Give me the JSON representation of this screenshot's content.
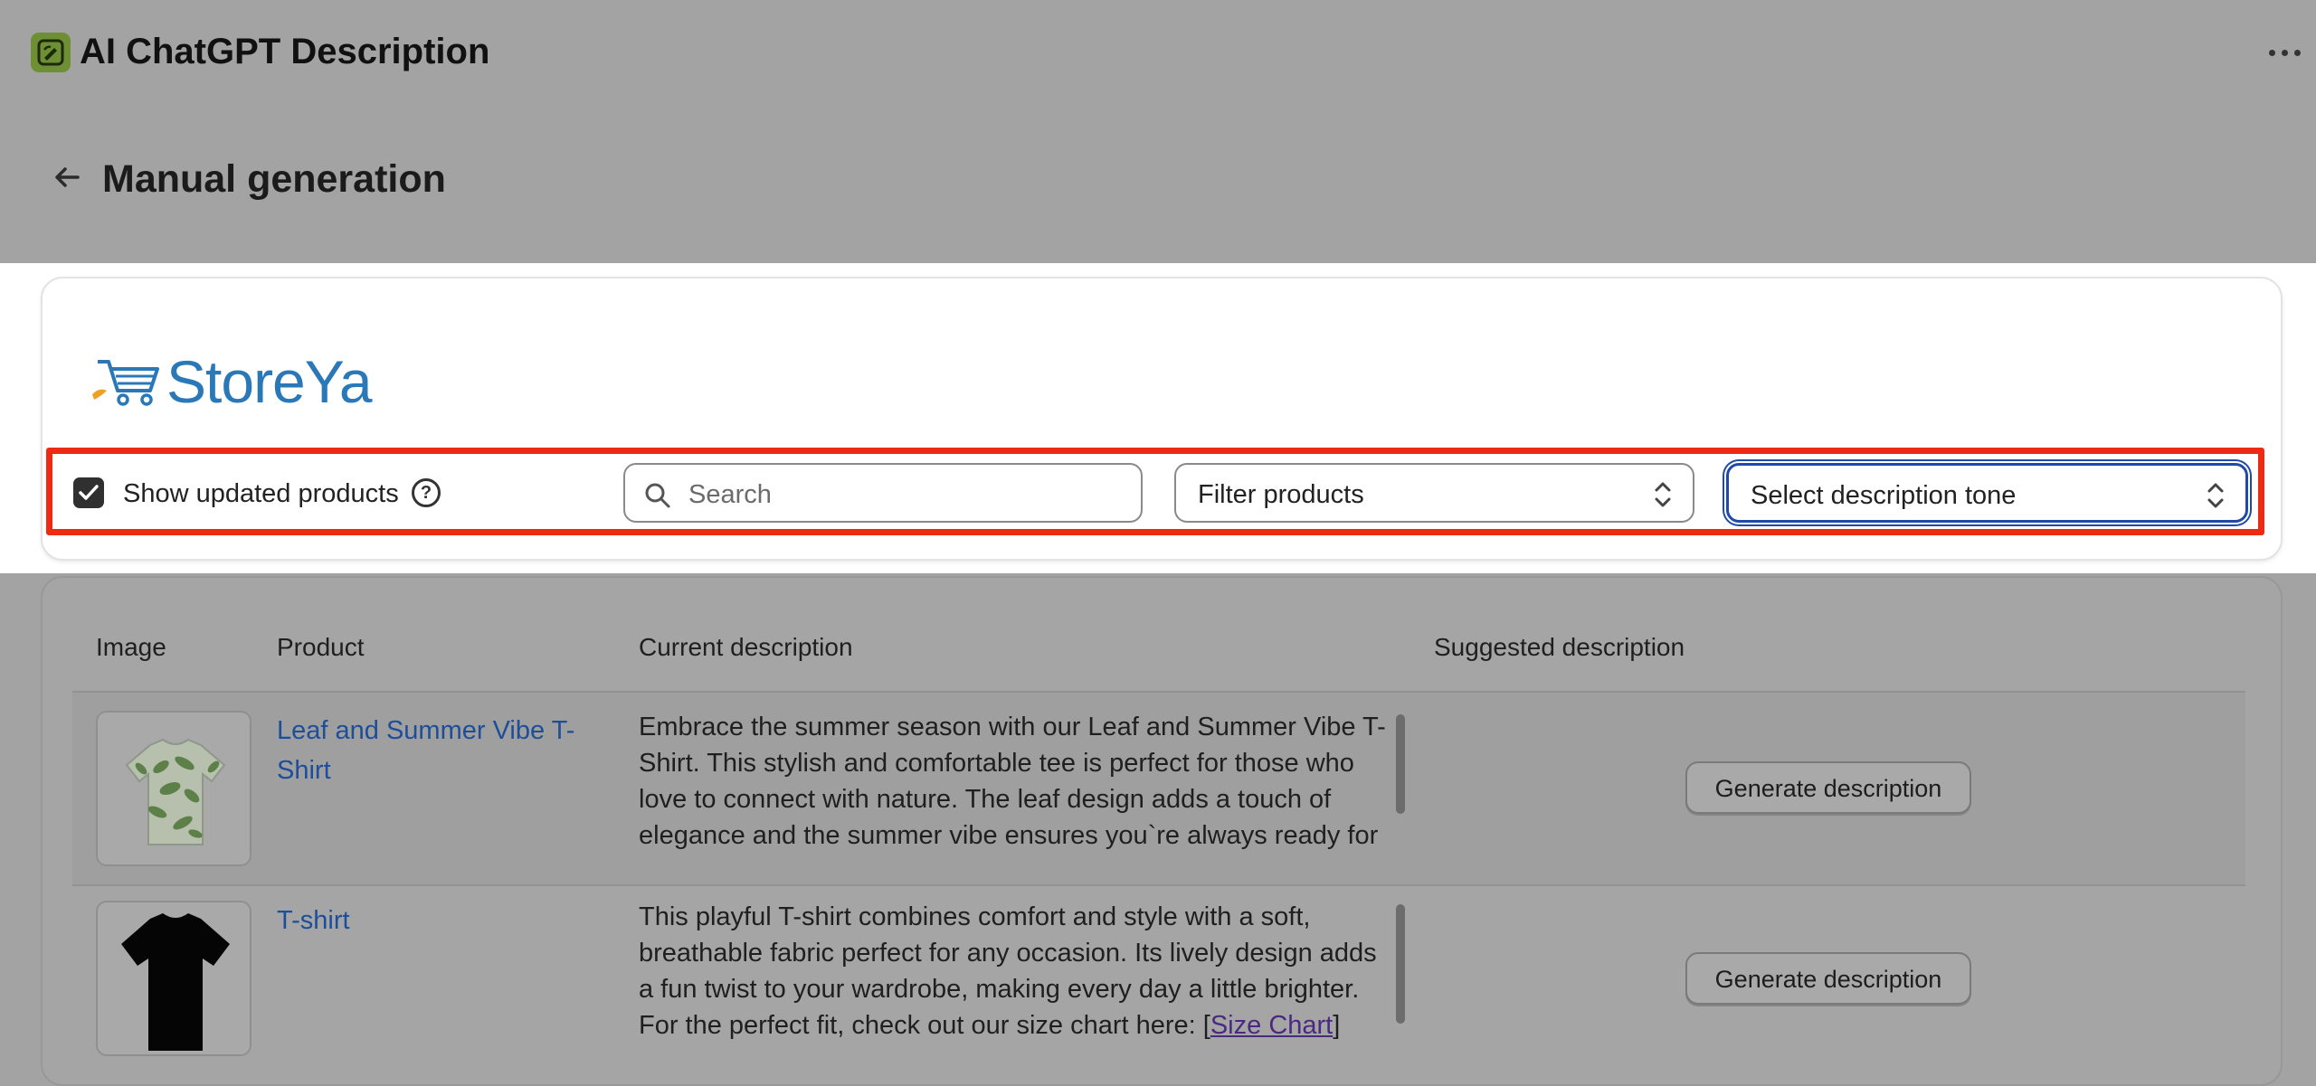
{
  "app": {
    "title": "AI ChatGPT Description",
    "icon": "app-logo-icon",
    "more_icon": "more-horizontal-icon"
  },
  "page": {
    "title": "Manual generation",
    "back_icon": "arrow-left-icon"
  },
  "brand": {
    "logo_text": "StoreYa",
    "logo_icon": "shopping-cart-icon"
  },
  "toolbar": {
    "show_updated_label": "Show updated products",
    "show_updated_checked": true,
    "help_icon": "question-circle-icon",
    "search_placeholder": "Search",
    "filter_label": "Filter products",
    "tone_label": "Select description tone"
  },
  "table": {
    "headers": {
      "image": "Image",
      "product": "Product",
      "current": "Current description",
      "suggested": "Suggested description"
    },
    "rows": [
      {
        "product": "Leaf and Summer Vibe T-Shirt",
        "description": "Embrace the summer season with our Leaf and Summer Vibe T-Shirt. This stylish and comfortable tee is perfect for those who love to connect with nature. The leaf design adds a touch of elegance and the summer vibe ensures you`re always ready for the beach or a casual day out with friends all summer long.",
        "button": "Generate description"
      },
      {
        "product": "T-shirt",
        "description": "This playful T-shirt combines comfort and style with a soft, breathable fabric perfect for any occasion. Its lively design adds a fun twist to your wardrobe, making every day a little brighter. For the perfect fit, check out our size chart here: [",
        "description_link": "Size Chart",
        "description_end": "]",
        "button": "Generate description"
      }
    ]
  },
  "colors": {
    "highlight": "#ee2a12",
    "link": "#1d4e9a",
    "brand": "#2a78b8",
    "focus": "#1f4aa8"
  }
}
